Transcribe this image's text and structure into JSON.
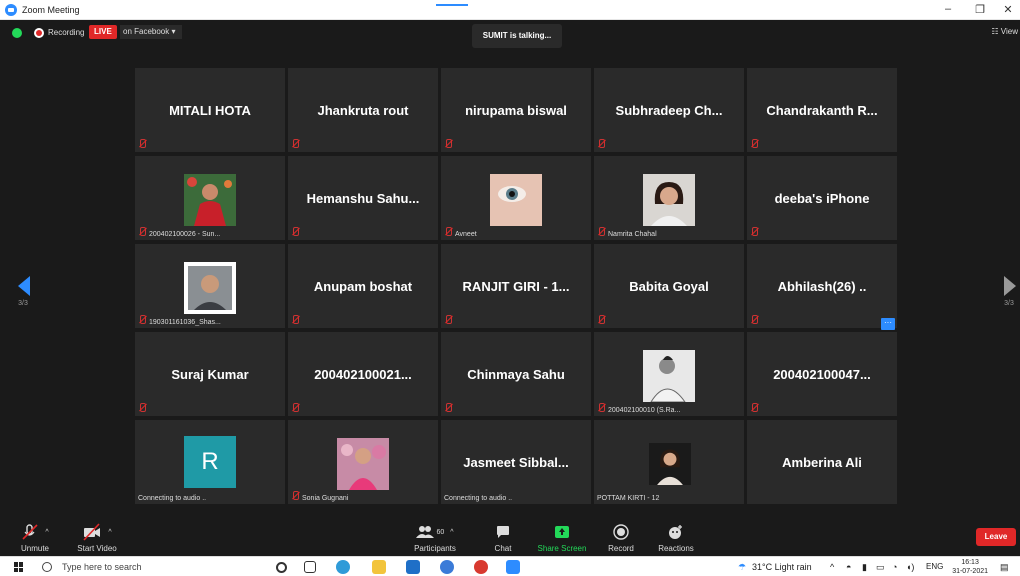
{
  "window": {
    "title": "Zoom Meeting"
  },
  "topbar": {
    "recording_label": "Recording",
    "live_label": "LIVE",
    "facebook_label": "on Facebook ▾",
    "talking_label": "SUMIT is talking...",
    "view_label": "☷ View"
  },
  "nav": {
    "left_page": "3/3",
    "right_page": "3/3"
  },
  "tiles": [
    {
      "name": "MITALI HOTA",
      "label": ""
    },
    {
      "name": "Jhankruta rout",
      "label": ""
    },
    {
      "name": "nirupama biswal",
      "label": ""
    },
    {
      "name": "Subhradeep Ch...",
      "label": ""
    },
    {
      "name": "Chandrakanth R...",
      "label": ""
    },
    {
      "name": "",
      "label": "200402100026 - Sun..."
    },
    {
      "name": "Hemanshu Sahu...",
      "label": ""
    },
    {
      "name": "",
      "label": "Avneet"
    },
    {
      "name": "",
      "label": "Namrita Chahal"
    },
    {
      "name": "deeba's iPhone",
      "label": ""
    },
    {
      "name": "",
      "label": "190301161036_Shas..."
    },
    {
      "name": "Anupam boshat",
      "label": ""
    },
    {
      "name": "RANJIT GIRI - 1...",
      "label": ""
    },
    {
      "name": "Babita Goyal",
      "label": ""
    },
    {
      "name": "Abhilash(26) ..",
      "label": ""
    },
    {
      "name": "Suraj Kumar",
      "label": ""
    },
    {
      "name": "200402100021...",
      "label": ""
    },
    {
      "name": "Chinmaya Sahu",
      "label": ""
    },
    {
      "name": "",
      "label": "200402100010 (S.Ra..."
    },
    {
      "name": "200402100047...",
      "label": "",
      "menu": "···"
    },
    {
      "name": "",
      "label": "Connecting to audio ..",
      "avatar_letter": "R"
    },
    {
      "name": "",
      "label": "Sonia Gugnani"
    },
    {
      "name": "Jasmeet Sibbal...",
      "label": "Connecting to audio .."
    },
    {
      "name": "",
      "label": "POTTAM KIRTI - 12"
    },
    {
      "name": "Amberina Ali",
      "label": ""
    }
  ],
  "toolbar": {
    "unmute": "Unmute",
    "start_video": "Start Video",
    "participants": "Participants",
    "participants_count": "60",
    "chat": "Chat",
    "share_screen": "Share Screen",
    "record": "Record",
    "reactions": "Reactions",
    "leave": "Leave"
  },
  "taskbar": {
    "search_placeholder": "Type here to search",
    "weather": "31°C  Light rain",
    "lang": "ENG",
    "time": "16:13",
    "date": "31-07-2021"
  },
  "colors": {
    "accent": "#2d8cff",
    "live_red": "#e02828",
    "share_green": "#23d959",
    "tile_bg": "#2a2a2a",
    "bg": "#1a1a1a"
  }
}
